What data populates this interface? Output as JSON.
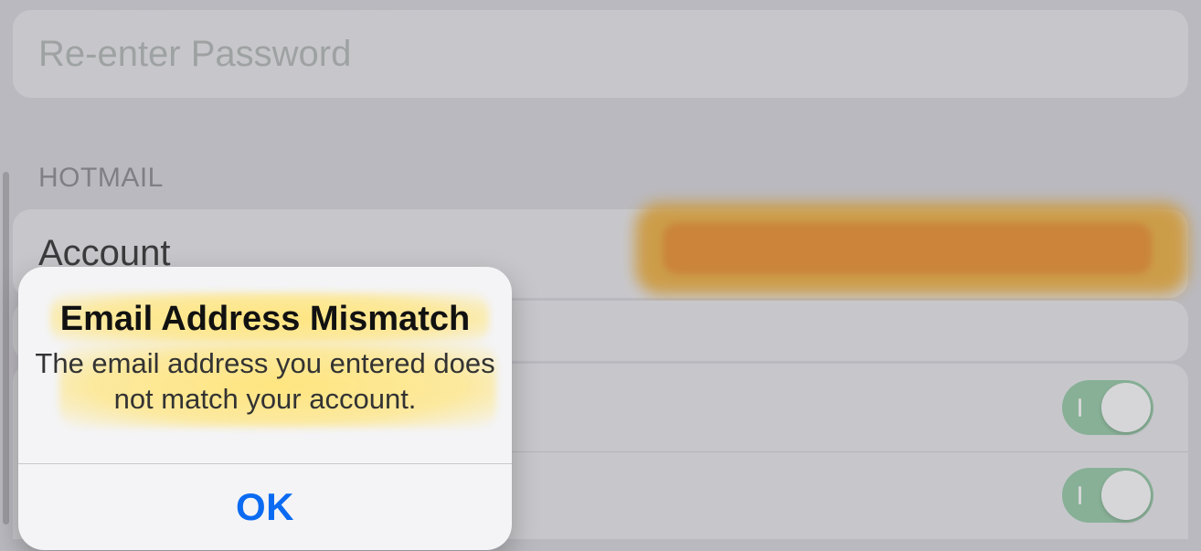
{
  "password_field": {
    "placeholder": "Re-enter Password"
  },
  "section": {
    "header": "HOTMAIL",
    "account_label": "Account",
    "account_value_redacted": true
  },
  "toggles": [
    {
      "label": "",
      "on": true
    },
    {
      "label": "",
      "on": true
    }
  ],
  "alert": {
    "title": "Email Address Mismatch",
    "message": "The email address you entered does not match your account.",
    "ok_label": "OK"
  },
  "highlight_color": "#ffe478",
  "redaction_colors": {
    "outer": "#f2ab2a",
    "inner": "#ef8a1d"
  },
  "toggle_on_color": "#8fc9a1",
  "link_color": "#0b6af2"
}
